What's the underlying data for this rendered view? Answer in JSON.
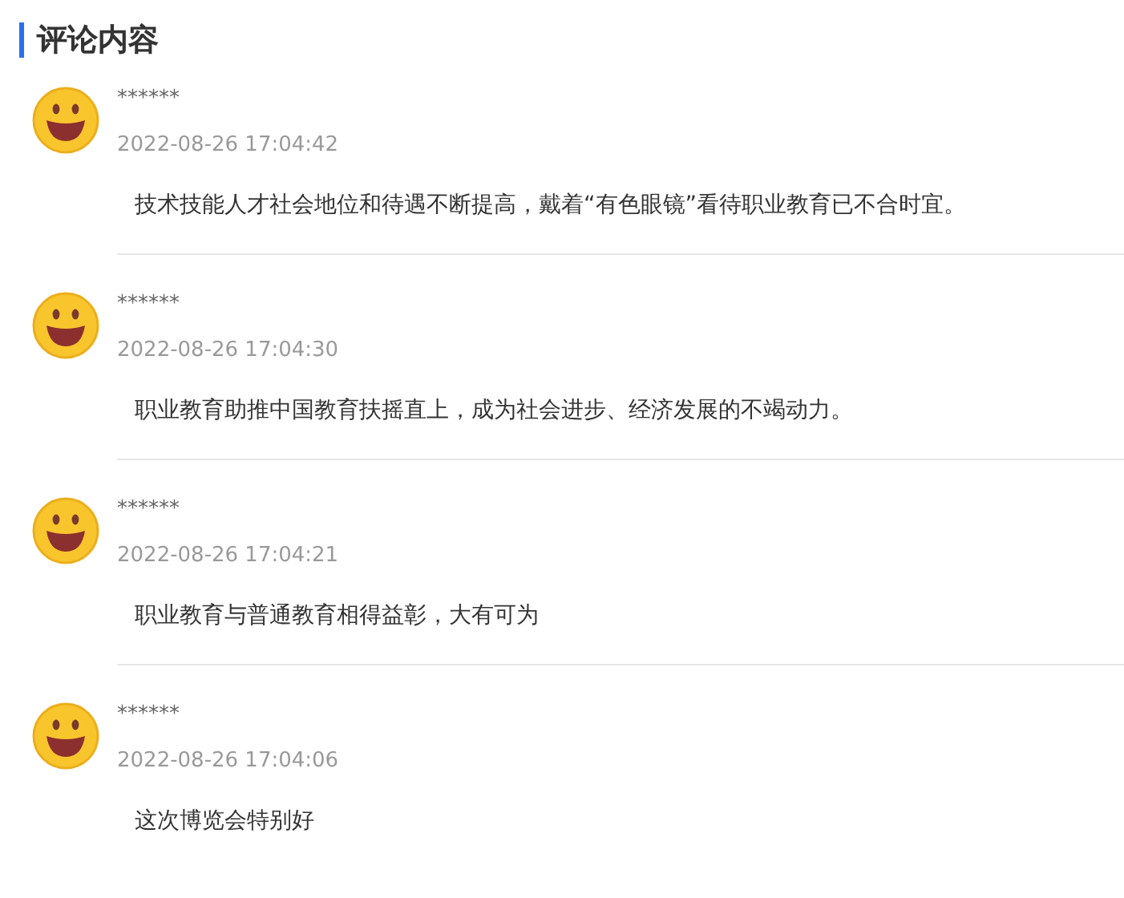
{
  "section": {
    "title": "评论内容"
  },
  "comments": [
    {
      "name": "******",
      "time": "2022-08-26 17:04:42",
      "text": "技术技能人才社会地位和待遇不断提高，戴着“有色眼镜”看待职业教育已不合时宜。"
    },
    {
      "name": "******",
      "time": "2022-08-26 17:04:30",
      "text": "职业教育助推中国教育扶摇直上，成为社会进步、经济发展的不竭动力。"
    },
    {
      "name": "******",
      "time": "2022-08-26 17:04:21",
      "text": "职业教育与普通教育相得益彰，大有可为"
    },
    {
      "name": "******",
      "time": "2022-08-26 17:04:06",
      "text": "这次博览会特别好"
    }
  ]
}
